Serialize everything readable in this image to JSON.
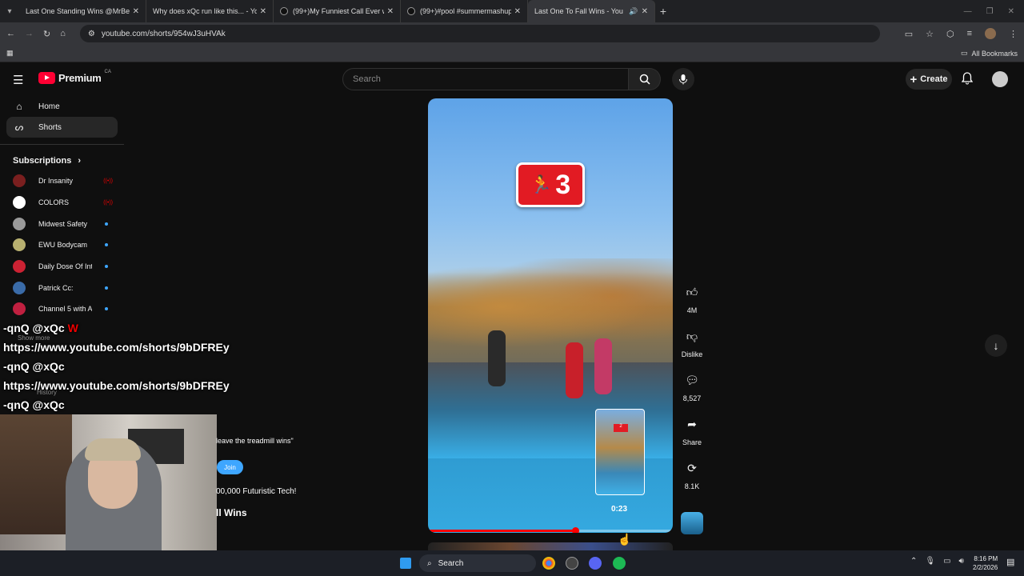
{
  "browser": {
    "tabs": [
      {
        "title": "Last One Standing Wins @MrBe",
        "icon": "youtube-favicon",
        "active": false
      },
      {
        "title": "Why does xQc run like this... - Yo",
        "icon": "youtube-favicon",
        "active": false
      },
      {
        "title": "(99+)My Funniest Call Ever with",
        "icon": "tiktok-favicon",
        "active": false
      },
      {
        "title": "(99+)#pool #summermashup #",
        "icon": "tiktok-favicon",
        "active": false
      },
      {
        "title": "Last One To Fall Wins - You",
        "icon": "youtube-favicon",
        "active": true
      }
    ],
    "url": "youtube.com/shorts/954wJ3uHVAk",
    "bookmarks_label": "All Bookmarks"
  },
  "masthead": {
    "logo_text": "Premium",
    "region": "CA",
    "search_placeholder": "Search",
    "create_label": "Create"
  },
  "sidebar": {
    "items": [
      {
        "label": "Home",
        "icon": "home-icon",
        "active": false
      },
      {
        "label": "Shorts",
        "icon": "shorts-icon",
        "active": true
      }
    ],
    "subscriptions_header": "Subscriptions",
    "subscriptions": [
      {
        "name": "Dr Insanity",
        "status": "live",
        "color": "#7a1f1f"
      },
      {
        "name": "COLORS",
        "status": "live",
        "color": "#ffffff"
      },
      {
        "name": "Midwest Safety",
        "status": "new",
        "color": "#9a9a9a"
      },
      {
        "name": "EWU Bodycam",
        "status": "new",
        "color": "#b8b070"
      },
      {
        "name": "Daily Dose Of Int...",
        "status": "new",
        "color": "#cc2233"
      },
      {
        "name": "Patrick Cc:",
        "status": "new",
        "color": "#3a6ba8"
      },
      {
        "name": "Channel 5 with A...",
        "status": "new",
        "color": "#c02040"
      }
    ],
    "show_more": "Show more",
    "history": "History"
  },
  "chat_overlay": [
    {
      "user": "-qnQ @xQc",
      "emote": "W"
    },
    {
      "text": "https://www.youtube.com/shorts/9bDFREy"
    },
    {
      "user": "-qnQ @xQc",
      "emote": ""
    },
    {
      "text": "https://www.youtube.com/shorts/9bDFREy"
    },
    {
      "user": "-qnQ @xQc",
      "emote": ""
    }
  ],
  "short": {
    "counter_value": "3",
    "preview_time": "0:23",
    "progress_fraction": 0.6,
    "description_line": "leave the treadmill wins\"",
    "join_label": "Join",
    "channel_tagline": "00,000 Futuristic Tech!",
    "title_fragment": "ll Wins"
  },
  "actions": {
    "like_count": "4M",
    "dislike_label": "Dislike",
    "comment_count": "8,527",
    "share_label": "Share",
    "remix_count": "8.1K"
  },
  "taskbar": {
    "search_label": "Search",
    "time": "8:16 PM",
    "date": "2/2/2026"
  },
  "colors": {
    "accent_red": "#ff0033",
    "join_blue": "#3ea6ff",
    "background": "#0f0f0f"
  }
}
